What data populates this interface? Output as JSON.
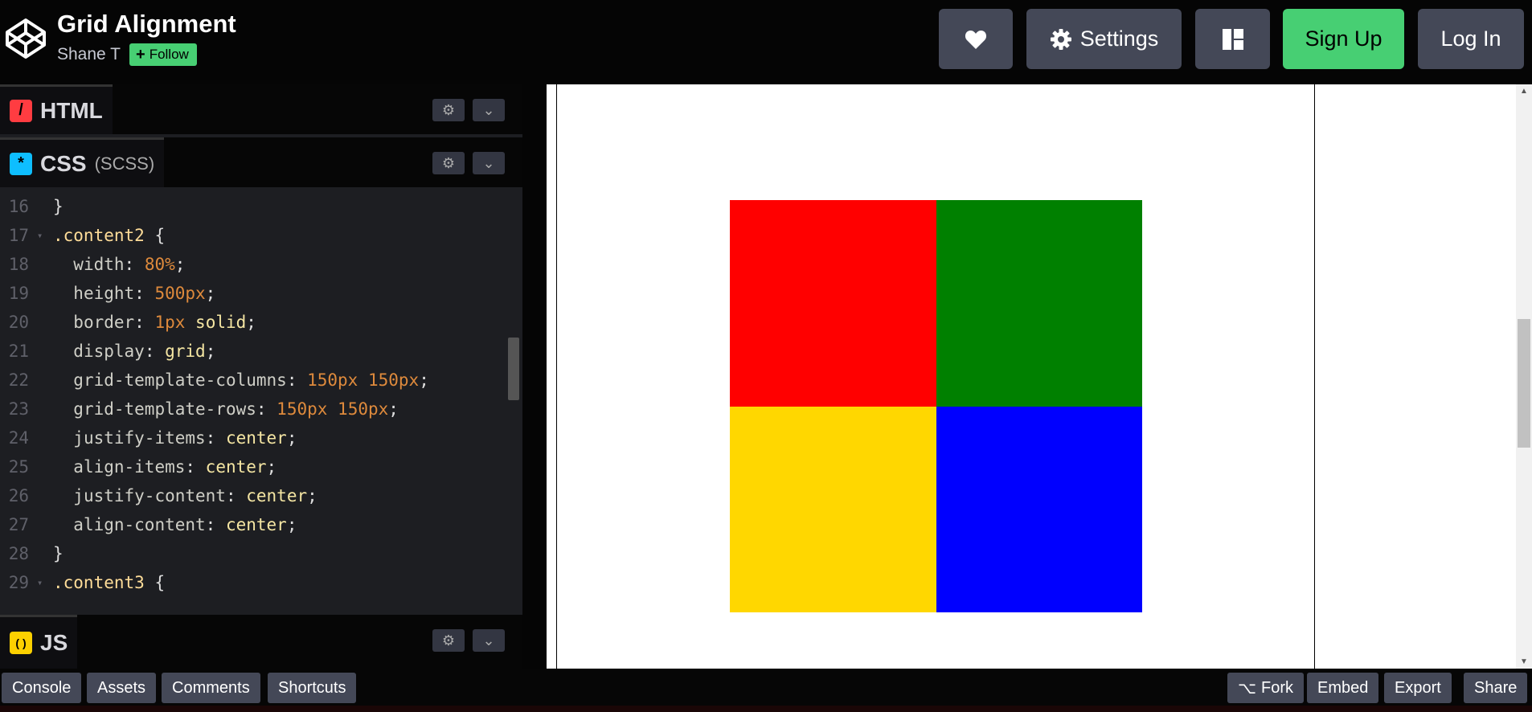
{
  "header": {
    "title": "Grid Alignment",
    "author": "Shane T",
    "follow_label": "Follow",
    "settings_label": "Settings",
    "signup_label": "Sign Up",
    "login_label": "Log In"
  },
  "panels": {
    "html": {
      "label": "HTML",
      "icon_glyph": "/"
    },
    "css": {
      "label": "CSS",
      "preprocessor": "(SCSS)",
      "icon_glyph": "*"
    },
    "js": {
      "label": "JS",
      "icon_glyph": "( )"
    }
  },
  "code_lines": [
    {
      "num": "16",
      "text": "}"
    },
    {
      "num": "17",
      "text": ".content2 {"
    },
    {
      "num": "18",
      "text": "  width: 80%;"
    },
    {
      "num": "19",
      "text": "  height: 500px;"
    },
    {
      "num": "20",
      "text": "  border: 1px solid;"
    },
    {
      "num": "21",
      "text": "  display: grid;"
    },
    {
      "num": "22",
      "text": "  grid-template-columns: 150px 150px;"
    },
    {
      "num": "23",
      "text": "  grid-template-rows: 150px 150px;"
    },
    {
      "num": "24",
      "text": "  justify-items: center;"
    },
    {
      "num": "25",
      "text": "  align-items: center;"
    },
    {
      "num": "26",
      "text": "  justify-content: center;"
    },
    {
      "num": "27",
      "text": "  align-content: center;"
    },
    {
      "num": "28",
      "text": "}"
    },
    {
      "num": "29",
      "text": ".content3 {"
    }
  ],
  "preview": {
    "cells": [
      "#ff0000",
      "#008000",
      "#ffd700",
      "#0000ff"
    ]
  },
  "footer": {
    "left": [
      "Console",
      "Assets",
      "Comments",
      "Shortcuts"
    ],
    "fork_label": "Fork",
    "embed_label": "Embed",
    "export_label": "Export",
    "share_label": "Share"
  },
  "colors": {
    "accent_green": "#47cf73",
    "button_gray": "#444857",
    "html_badge": "#ff3c41",
    "css_badge": "#0ebeff",
    "js_badge": "#fcd000"
  }
}
